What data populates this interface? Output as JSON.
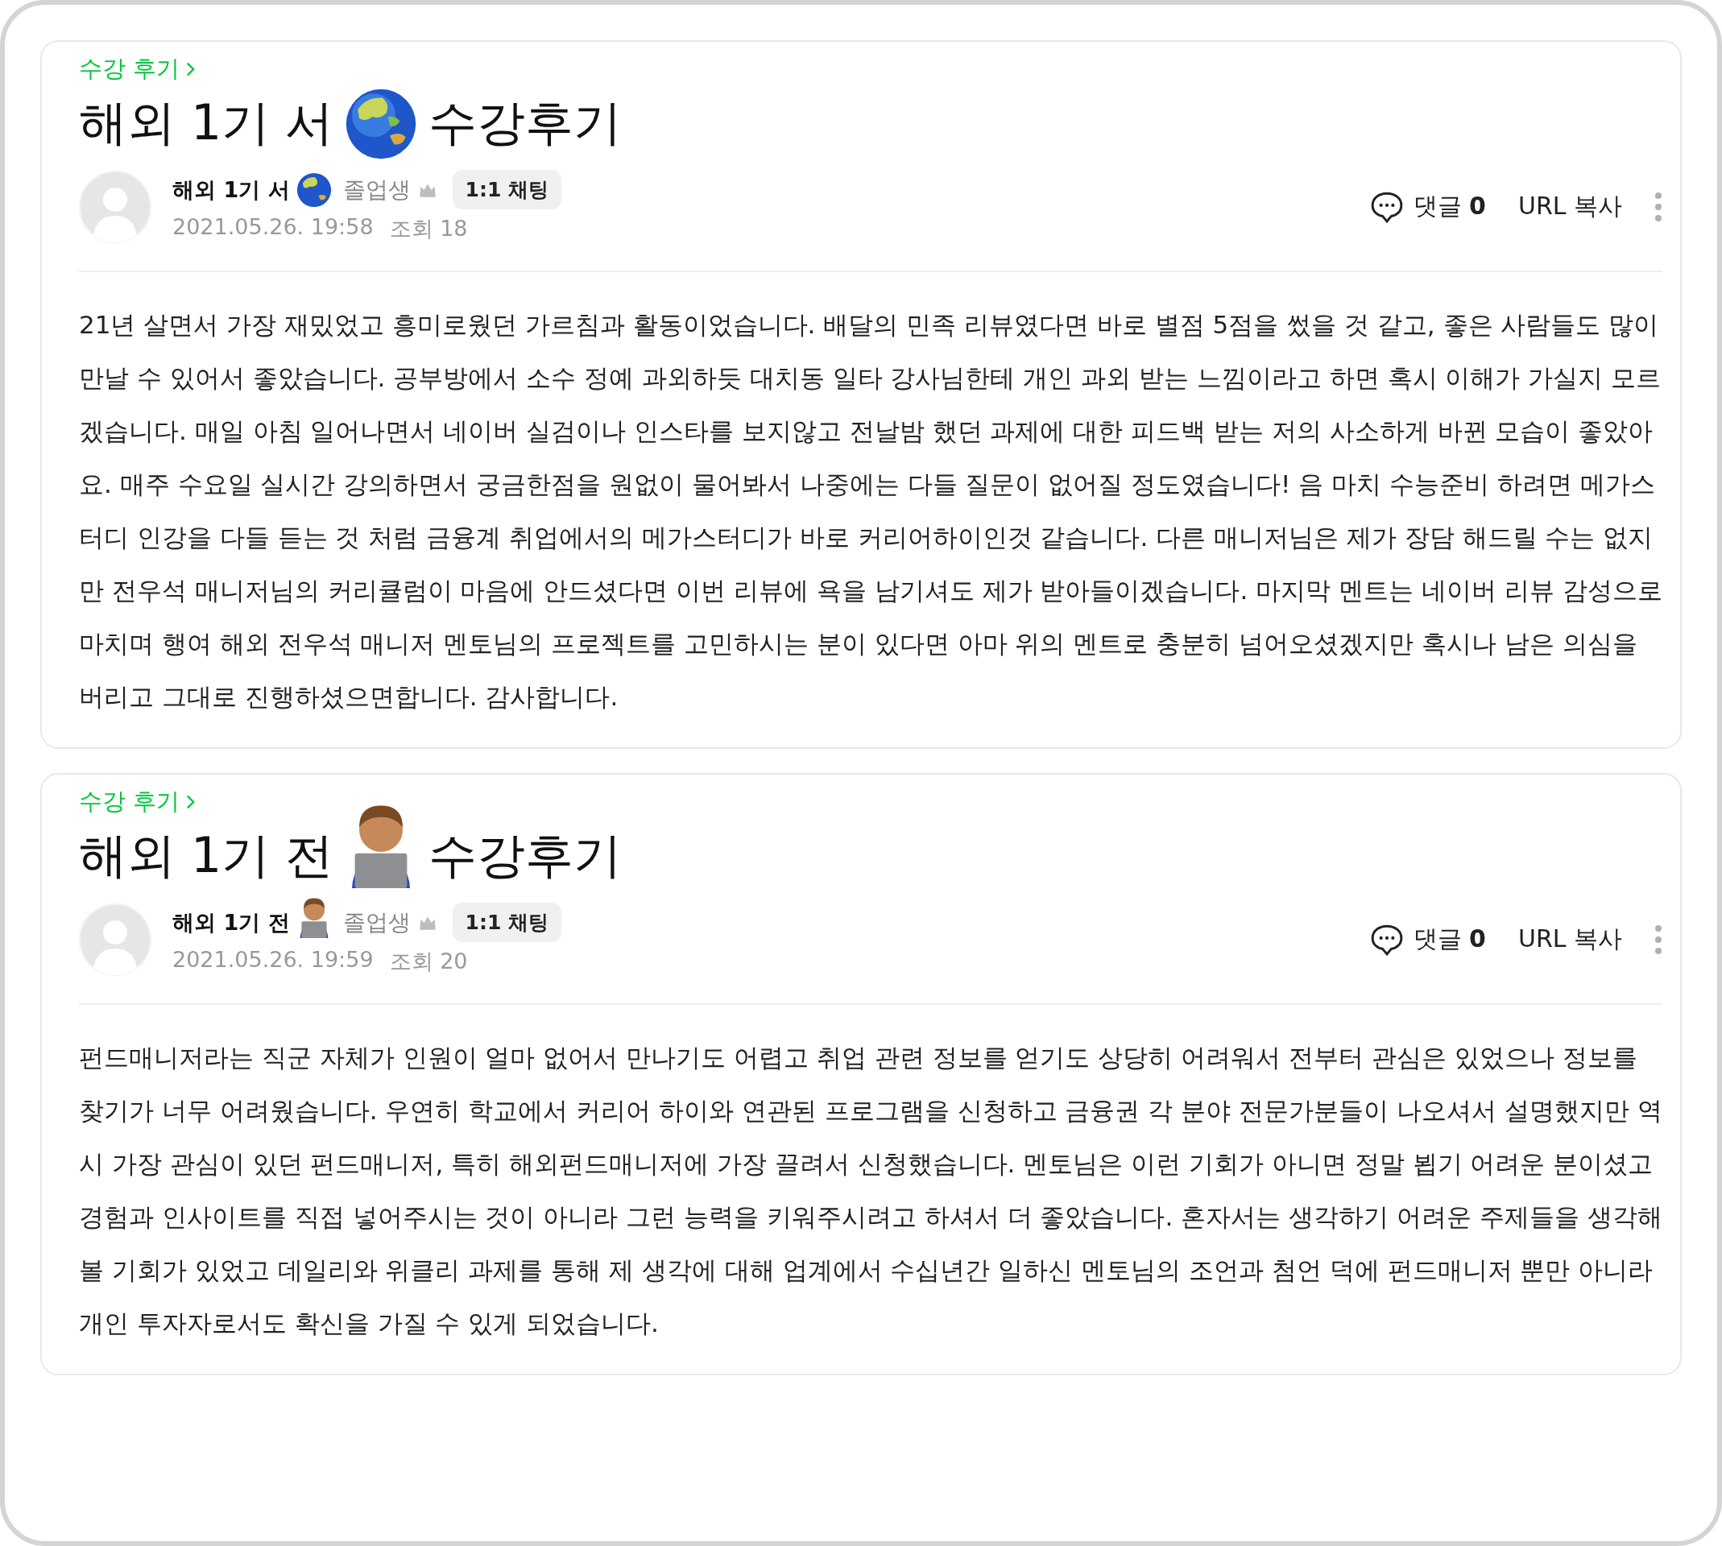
{
  "posts": [
    {
      "category": "수강 후기",
      "title_before": "해외 1기 서",
      "title_icon": {
        "kind": "globe"
      },
      "title_after": "수강후기",
      "author": {
        "name": "해외 1기 서",
        "icon": {
          "kind": "globe"
        },
        "role": "졸업생",
        "chat": "1:1 채팅"
      },
      "date": "2021.05.26. 19:58",
      "views": "조회 18",
      "comments_label": "댓글",
      "comments_count": "0",
      "url_copy": "URL 복사",
      "body": "21년 살면서 가장 재밌었고 흥미로웠던 가르침과 활동이었습니다. 배달의 민족 리뷰였다면 바로 별점 5점을 썼을 것 같고, 좋은 사람들도 많이 만날 수 있어서 좋았습니다. 공부방에서 소수 정예 과외하듯 대치동 일타 강사님한테 개인 과외 받는 느낌이라고 하면 혹시 이해가 가실지 모르겠습니다. 매일 아침 일어나면서 네이버 실검이나 인스타를 보지않고 전날밤 했던 과제에 대한 피드백 받는 저의 사소하게 바뀐 모습이 좋았아요. 매주 수요일 실시간 강의하면서 궁금한점을 원없이 물어봐서 나중에는 다들 질문이 없어질 정도였습니다! 음 마치 수능준비 하려면 메가스터디 인강을 다들 듣는 것 처럼 금융계 취업에서의 메가스터디가 바로 커리어하이인것 같습니다. 다른 매니저님은 제가 장담 해드릴 수는 없지만 전우석 매니저님의 커리큘럼이 마음에 안드셨다면 이번 리뷰에 욕을 남기셔도 제가 받아들이겠습니다. 마지막 멘트는 네이버 리뷰 감성으로 마치며 행여 해외 전우석 매니저 멘토님의 프로젝트를 고민하시는 분이 있다면 아마 위의 멘트로 충분히 넘어오셨겠지만 혹시나 남은 의심을 버리고 그대로 진행하셨으면합니다. 감사합니다."
    },
    {
      "category": "수강 후기",
      "title_before": "해외 1기 전",
      "title_icon": {
        "kind": "person-laptop"
      },
      "title_after": "수강후기",
      "author": {
        "name": "해외 1기 전",
        "icon": {
          "kind": "person-laptop"
        },
        "role": "졸업생",
        "chat": "1:1 채팅"
      },
      "date": "2021.05.26. 19:59",
      "views": "조회 20",
      "comments_label": "댓글",
      "comments_count": "0",
      "url_copy": "URL 복사",
      "body": "펀드매니저라는 직군 자체가 인원이 얼마 없어서 만나기도 어렵고 취업 관련 정보를 얻기도 상당히 어려워서 전부터 관심은 있었으나 정보를 찾기가 너무 어려웠습니다. 우연히 학교에서 커리어 하이와 연관된 프로그램을 신청하고 금융권 각 분야 전문가분들이 나오셔서 설명했지만 역시 가장 관심이 있던 펀드매니저, 특히 해외펀드매니저에 가장 끌려서 신청했습니다. 멘토님은 이런 기회가 아니면 정말 뵙기 어려운 분이셨고 경험과 인사이트를 직접 넣어주시는 것이 아니라 그런 능력을 키워주시려고 하셔서 더 좋았습니다. 혼자서는 생각하기 어려운 주제들을 생각해볼 기회가 있었고 데일리와 위클리 과제를 통해 제 생각에 대해 업계에서 수십년간 일하신 멘토님의 조언과 첨언 덕에 펀드매니저 뿐만 아니라 개인 투자자로서도 확신을 가질 수 있게 되었습니다."
    }
  ]
}
